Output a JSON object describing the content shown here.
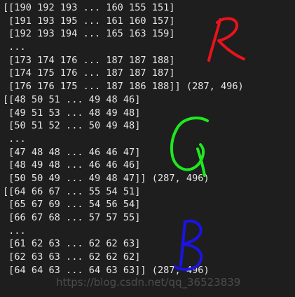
{
  "console": {
    "lines": [
      "[[190 192 193 ... 160 155 151]",
      " [191 193 195 ... 161 160 157]",
      " [192 193 194 ... 165 163 159]",
      " ...",
      " [173 174 176 ... 187 187 188]",
      " [174 175 176 ... 187 187 187]",
      " [176 176 175 ... 187 186 188]] (287, 496)",
      "[[48 50 51 ... 49 48 46]",
      " [49 51 53 ... 48 49 48]",
      " [50 51 52 ... 50 49 48]",
      " ...",
      " [47 48 48 ... 46 46 47]",
      " [48 49 48 ... 46 46 46]",
      " [50 50 49 ... 49 48 47]] (287, 496)",
      "[[64 66 67 ... 55 54 51]",
      " [65 67 69 ... 54 56 54]",
      " [66 67 68 ... 57 57 55]",
      " ...",
      " [61 62 63 ... 62 62 63]",
      " [62 63 63 ... 62 62 62]",
      " [64 64 63 ... 64 63 63]] (287, 496)"
    ]
  },
  "annotations": {
    "r": {
      "text": "R",
      "color": "#e8131c"
    },
    "g": {
      "text": "G",
      "color": "#1ee81e"
    },
    "b": {
      "text": "B",
      "color": "#1a14e6"
    }
  },
  "watermark": "https://blog.csdn.net/qq_36523839"
}
